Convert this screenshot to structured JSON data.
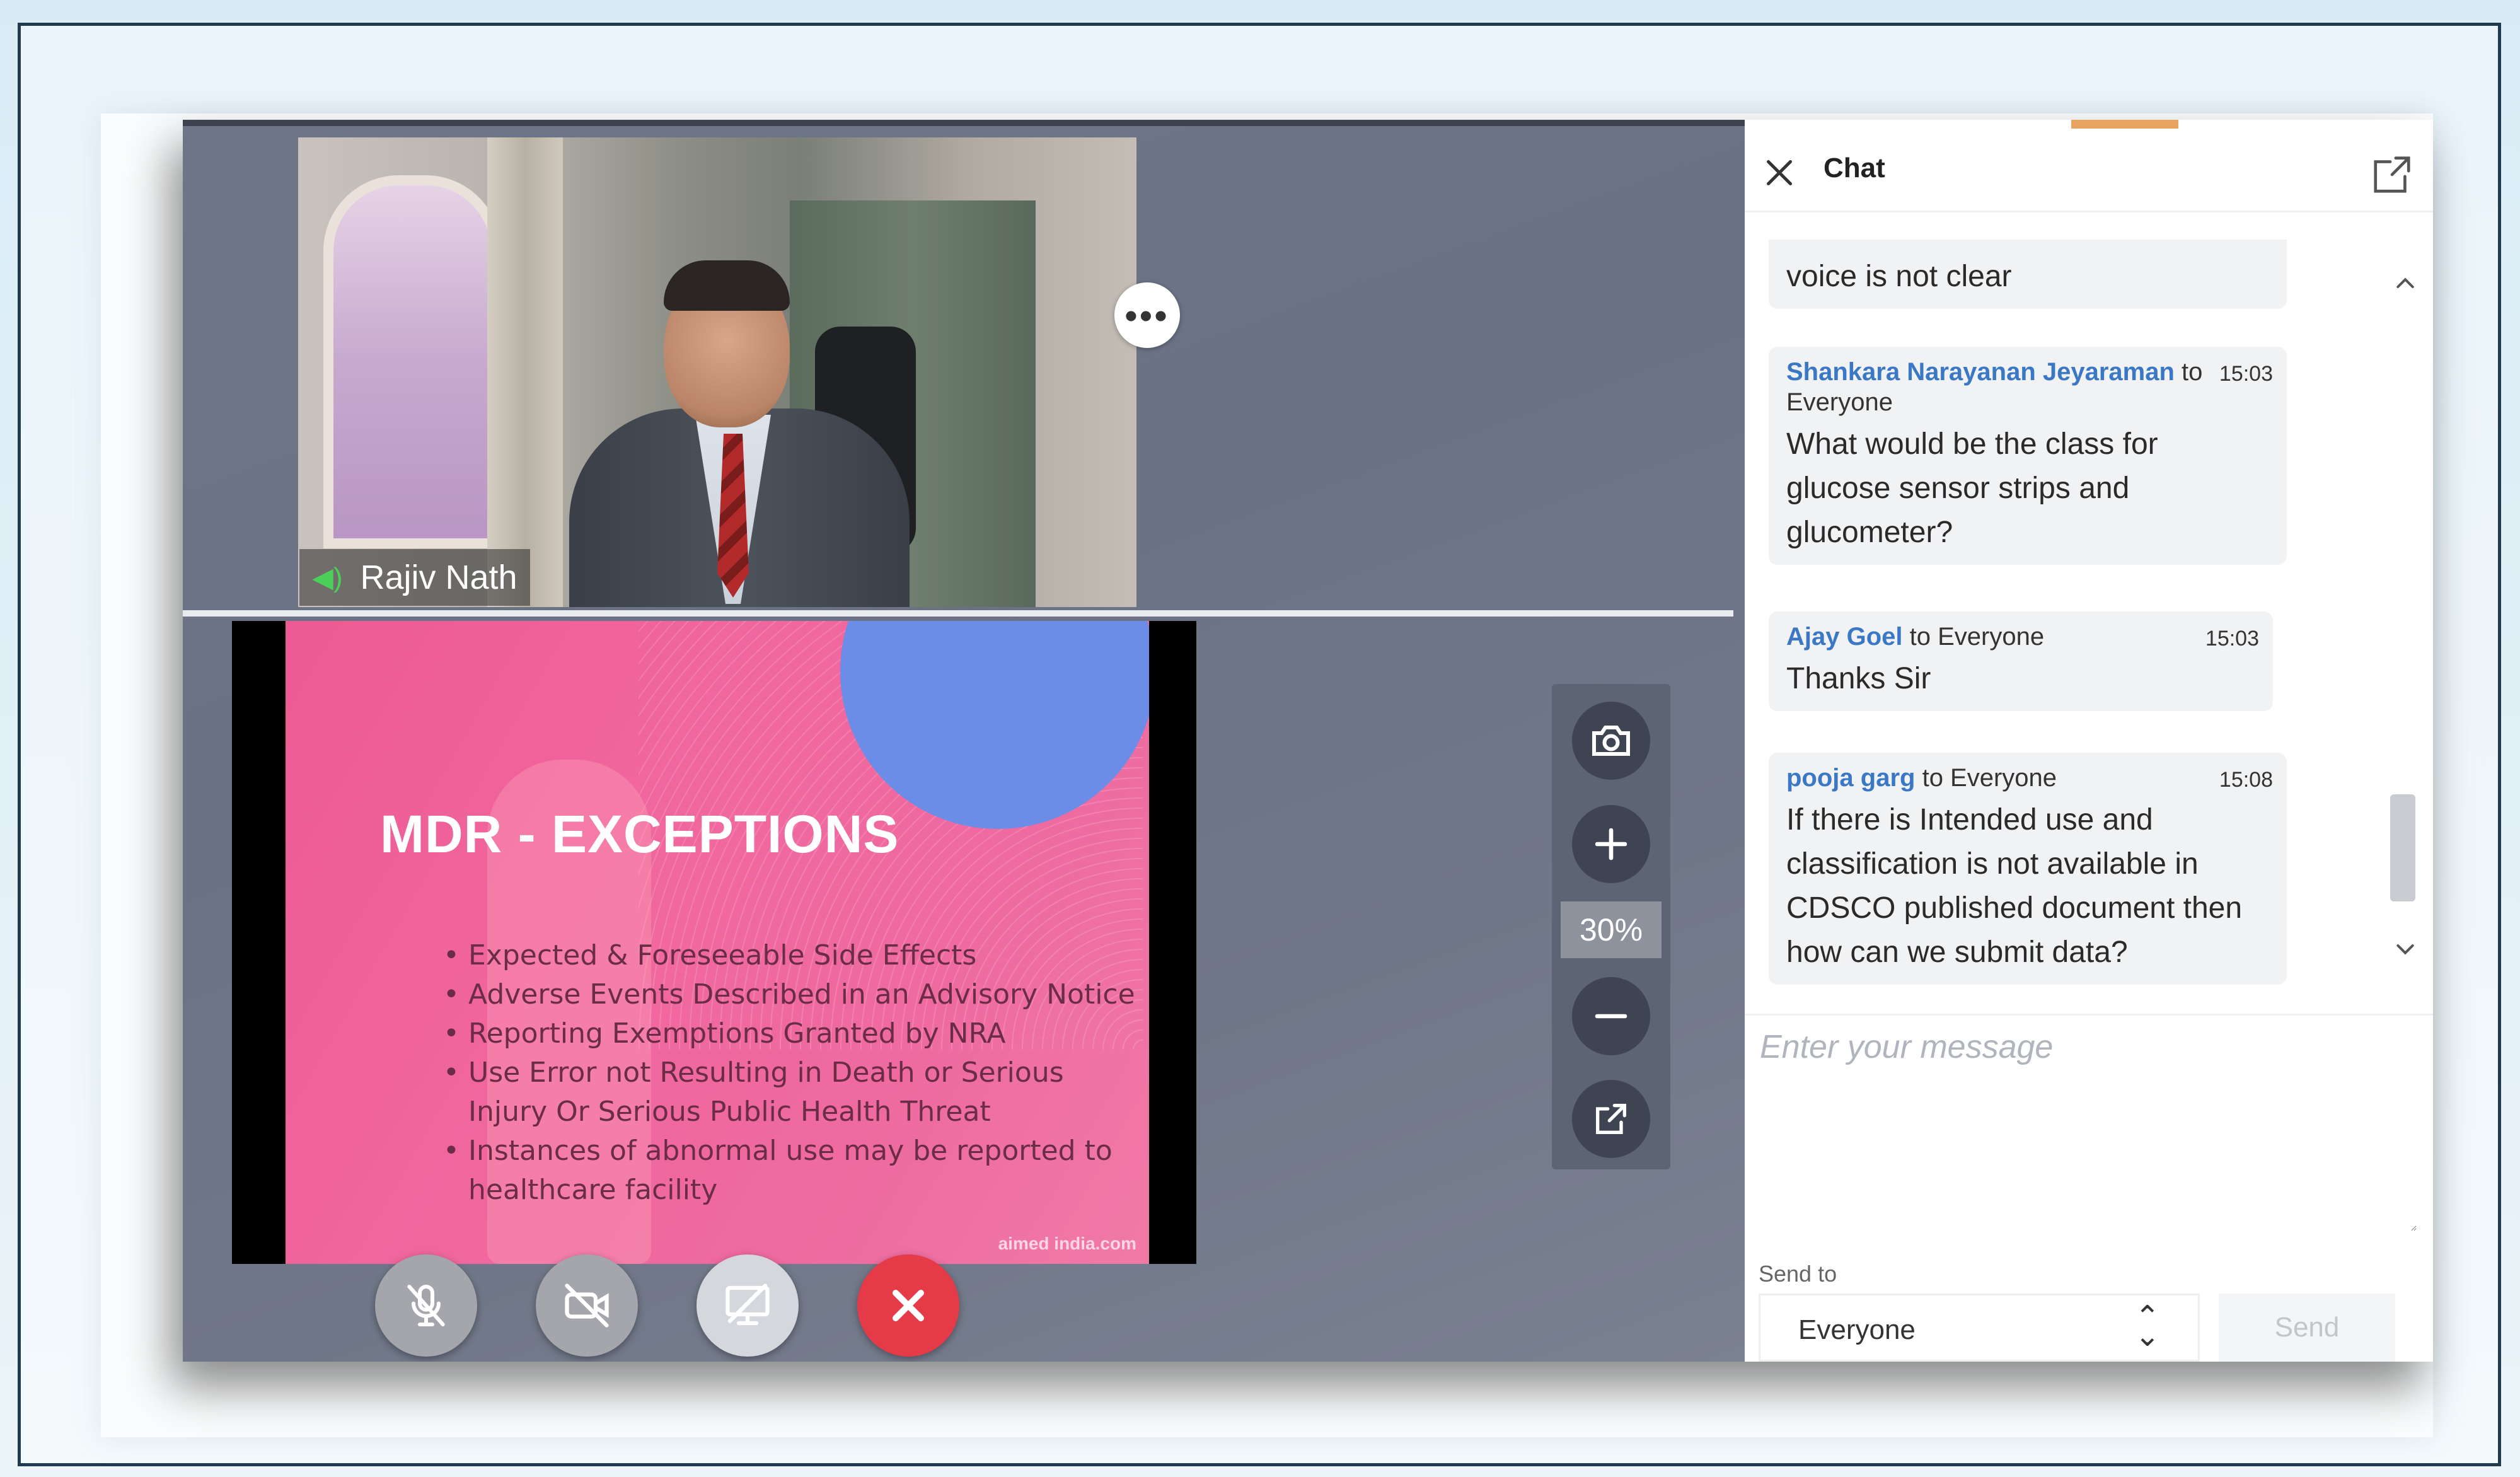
{
  "participant": {
    "name": "Rajiv Nath",
    "more_icon": "more-horizontal-icon",
    "audio_icon": "speaker-active-icon"
  },
  "slide": {
    "title": "MDR - EXCEPTIONS",
    "bullets": [
      "Expected & Foreseeable Side Effects",
      "Adverse Events Described in an Advisory Notice",
      "Reporting Exemptions Granted by NRA",
      "Use Error not Resulting in Death or Serious Injury Or Serious Public Health Threat",
      "Instances of abnormal use may be reported to healthcare facility"
    ],
    "footer": "aimed india.com",
    "colors": {
      "background": "#ee5a93",
      "circle": "#6b8de8"
    }
  },
  "zoom": {
    "percent": "30%",
    "icons": [
      "camera-icon",
      "zoom-in-icon",
      "zoom-out-icon",
      "popout-icon"
    ]
  },
  "call_controls": {
    "icons": [
      "mic-off-icon",
      "video-off-icon",
      "screen-share-icon",
      "end-call-icon"
    ],
    "end_color": "#e53a48"
  },
  "chat": {
    "title": "Chat",
    "messages": [
      {
        "sender": "",
        "recipient": "",
        "time": "",
        "text": "voice is not clear"
      },
      {
        "sender": "Shankara Narayanan Jeyaraman",
        "recipient": "to Everyone",
        "time": "15:03",
        "text": "What would be the class for glucose sensor strips and glucometer?"
      },
      {
        "sender": "Ajay Goel",
        "recipient": "to Everyone",
        "time": "15:03",
        "text": "Thanks Sir"
      },
      {
        "sender": "pooja garg",
        "recipient": "to Everyone",
        "time": "15:08",
        "text": "If there is Intended use and classification is not available in CDSCO published document then how can we submit data?"
      }
    ],
    "input_placeholder": "Enter your message",
    "send_to_label": "Send to",
    "send_to_value": "Everyone",
    "send_label": "Send",
    "accent_color": "#3a78c5"
  }
}
